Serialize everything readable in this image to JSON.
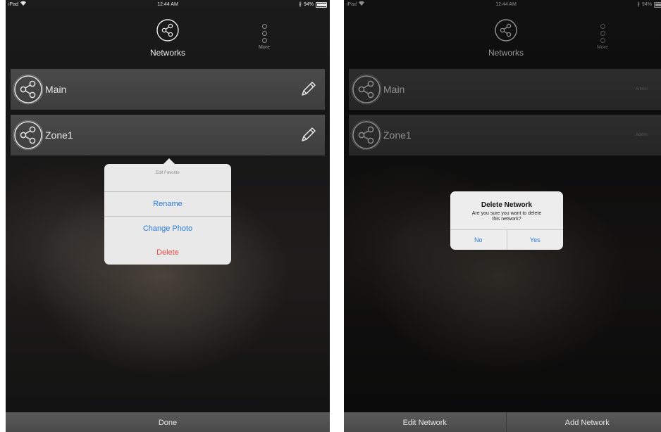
{
  "status_bar": {
    "device": "iPad",
    "time": "12:44 AM",
    "battery": "94%",
    "battery_level": 0.94
  },
  "nav": {
    "title": "Networks",
    "more_label": "More",
    "logo_icon": "share-network-icon"
  },
  "left": {
    "networks": [
      {
        "name": "Main"
      },
      {
        "name": "Zone1"
      }
    ],
    "popover": {
      "title": "Edit Favorite",
      "items": [
        "Rename",
        "Change Photo",
        "Delete"
      ]
    },
    "bottom": {
      "done_label": "Done"
    }
  },
  "right": {
    "networks": [
      {
        "name": "Main",
        "role": "Admin"
      },
      {
        "name": "Zone1",
        "role": "Admin"
      }
    ],
    "alert": {
      "title": "Delete Network",
      "message": "Are you sure you want to delete this network?",
      "no_label": "No",
      "yes_label": "Yes"
    },
    "bottom": {
      "edit_label": "Edit Network",
      "add_label": "Add Network"
    }
  },
  "colors": {
    "accent_blue": "#2b7bd9",
    "destructive_red": "#e24b45"
  }
}
